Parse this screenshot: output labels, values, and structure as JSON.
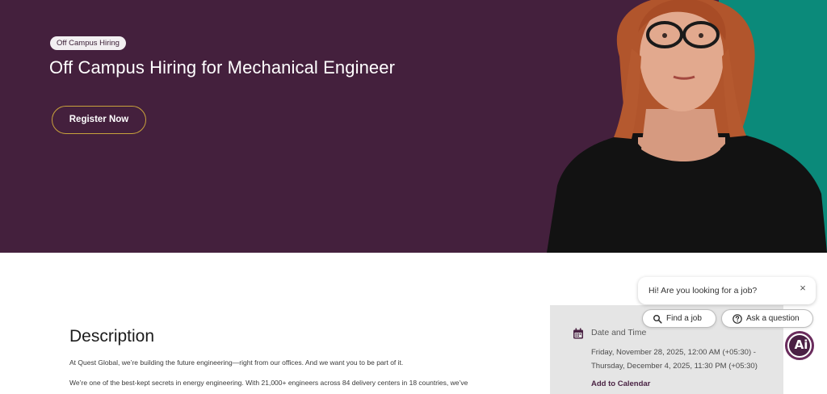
{
  "hero": {
    "tag": "Off Campus Hiring",
    "title": "Off Campus Hiring for Mechanical Engineer",
    "register_label": "Register Now",
    "colors": {
      "background": "#44203d",
      "accent_teal": "#0b8a7a",
      "button_border": "#c9a23c"
    }
  },
  "description": {
    "heading": "Description",
    "paragraphs": [
      "At Quest Global, we’re building the future engineering—right from our offices. And we want you to be part of it.",
      "We’re one of the best-kept secrets in energy engineering. With 21,000+ engineers across 84 delivery centers in 18 countries, we’ve"
    ]
  },
  "event": {
    "label": "Date and Time",
    "line1": "Friday, November 28, 2025, 12:00 AM (+05:30) -",
    "line2": "Thursday, December 4, 2025, 11:30 PM (+05:30)",
    "add_calendar": "Add to Calendar",
    "icon": "calendar-icon"
  },
  "chat": {
    "greeting": "Hi! Are you looking for a job?",
    "close_symbol": "×",
    "find_job": "Find a job",
    "ask_question": "Ask a question",
    "badge": "Ai",
    "icons": [
      "search-icon",
      "question-icon",
      "close-icon"
    ]
  }
}
